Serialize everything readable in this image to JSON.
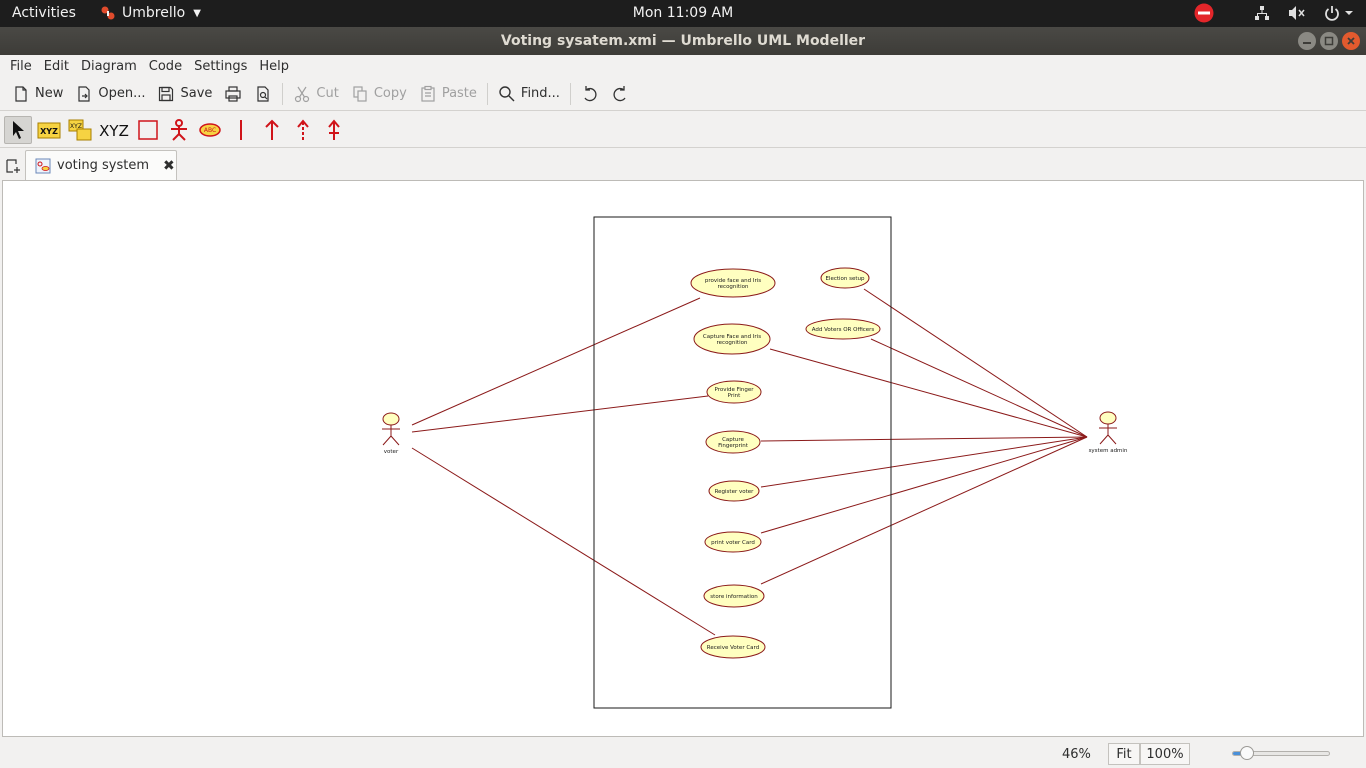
{
  "topbar": {
    "activities": "Activities",
    "app_name": "Umbrello",
    "clock": "Mon 11:09 AM"
  },
  "window": {
    "title": "Voting sysatem.xmi  — Umbrello UML Modeller"
  },
  "menu": {
    "items": [
      "File",
      "Edit",
      "Diagram",
      "Code",
      "Settings",
      "Help"
    ]
  },
  "toolbar": {
    "new": "New",
    "open": "Open...",
    "save": "Save",
    "cut": "Cut",
    "copy": "Copy",
    "paste": "Paste",
    "find": "Find..."
  },
  "diagram_tools": {
    "class_label": "XYZ"
  },
  "tabs": {
    "active": "voting system"
  },
  "diagram": {
    "line_color": "#8b1a1a",
    "usecase_fill": "#ffffc0",
    "actors": [
      {
        "id": "voter",
        "name": "voter"
      },
      {
        "id": "admin",
        "name": "system admin"
      }
    ],
    "usecases": [
      {
        "id": "uc1",
        "lines": [
          "provide face and Iris",
          "recognition"
        ]
      },
      {
        "id": "uc2",
        "lines": [
          "Capture Face and Iris",
          "recognition"
        ]
      },
      {
        "id": "uc3",
        "lines": [
          "Provide Finger",
          "Print"
        ]
      },
      {
        "id": "uc4",
        "lines": [
          "Capture",
          "Fingerprint"
        ]
      },
      {
        "id": "uc5",
        "lines": [
          "Register voter"
        ]
      },
      {
        "id": "uc6",
        "lines": [
          "print voter Card"
        ]
      },
      {
        "id": "uc7",
        "lines": [
          "store information"
        ]
      },
      {
        "id": "uc8",
        "lines": [
          "Receive Voter Card"
        ]
      },
      {
        "id": "uc9",
        "lines": [
          "Election setup"
        ]
      },
      {
        "id": "uc10",
        "lines": [
          "Add Voters OR Officers"
        ]
      }
    ],
    "associations": [
      [
        "voter",
        "uc1"
      ],
      [
        "voter",
        "uc3"
      ],
      [
        "voter",
        "uc8"
      ],
      [
        "admin",
        "uc2"
      ],
      [
        "admin",
        "uc4"
      ],
      [
        "admin",
        "uc5"
      ],
      [
        "admin",
        "uc6"
      ],
      [
        "admin",
        "uc7"
      ],
      [
        "admin",
        "uc9"
      ],
      [
        "admin",
        "uc10"
      ]
    ]
  },
  "status": {
    "zoom": "46%",
    "fit": "Fit",
    "hundred": "100%",
    "zoom_slider_fraction": 0.1
  }
}
